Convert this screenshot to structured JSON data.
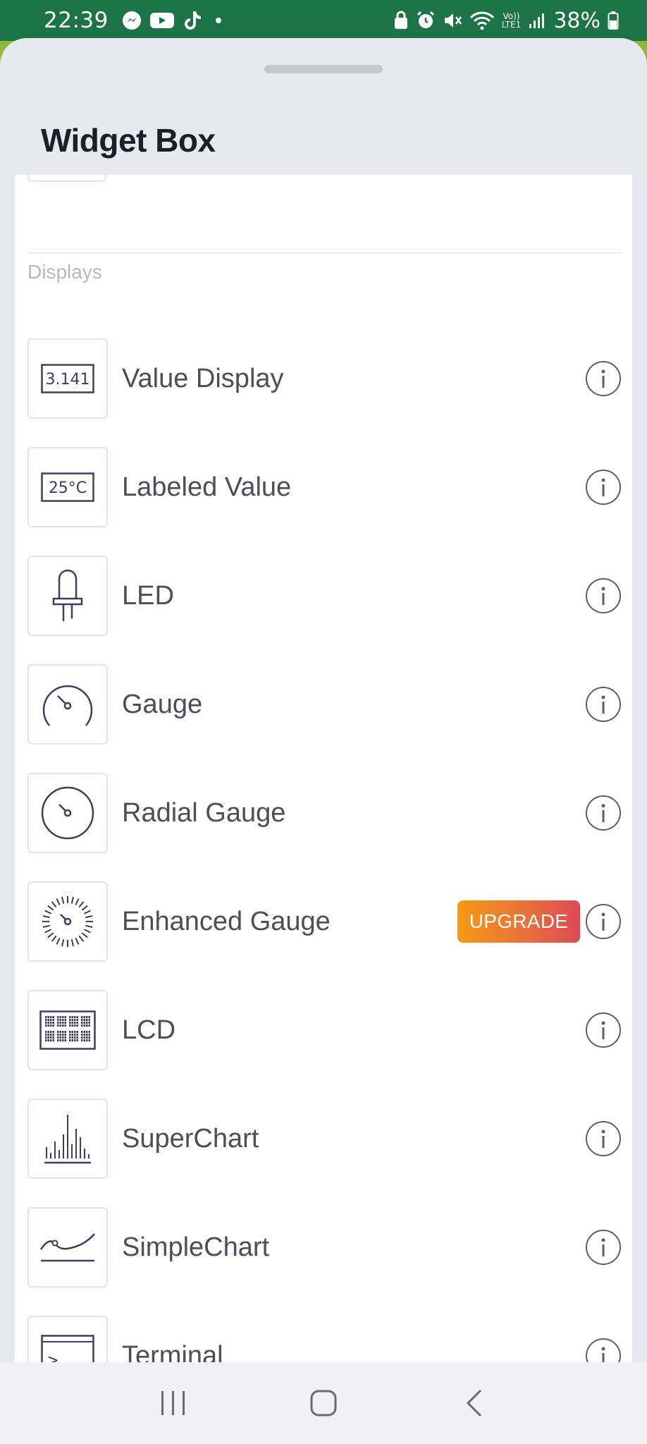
{
  "status_bar": {
    "time": "22:39",
    "battery": "38%",
    "left_icons": [
      "messenger-icon",
      "youtube-icon",
      "tiktok-icon",
      "dot-icon"
    ],
    "right_icons": [
      "sim-lock-icon",
      "alarm-icon",
      "mute-icon",
      "wifi-icon",
      "volte-icon",
      "signal-icon",
      "battery-icon"
    ],
    "network_label_top": "Vo))",
    "network_label_bottom": "LTE1"
  },
  "sheet": {
    "title": "Widget Box",
    "section": "Displays"
  },
  "widgets": [
    {
      "label": "Value Display",
      "icon": "value-display-icon",
      "icon_text": "3.141",
      "upgrade": ""
    },
    {
      "label": "Labeled Value",
      "icon": "labeled-value-icon",
      "icon_text": "25°C",
      "upgrade": ""
    },
    {
      "label": "LED",
      "icon": "led-icon",
      "upgrade": ""
    },
    {
      "label": "Gauge",
      "icon": "gauge-icon",
      "upgrade": ""
    },
    {
      "label": "Radial Gauge",
      "icon": "radial-gauge-icon",
      "upgrade": ""
    },
    {
      "label": "Enhanced Gauge",
      "icon": "enhanced-gauge-icon",
      "upgrade": "UPGRADE"
    },
    {
      "label": "LCD",
      "icon": "lcd-icon",
      "upgrade": ""
    },
    {
      "label": "SuperChart",
      "icon": "superchart-icon",
      "upgrade": ""
    },
    {
      "label": "SimpleChart",
      "icon": "simplechart-icon",
      "upgrade": ""
    },
    {
      "label": "Terminal",
      "icon": "terminal-icon",
      "icon_text": ">_",
      "upgrade": ""
    }
  ],
  "nav": {
    "recents": "recents-icon",
    "home": "home-icon",
    "back": "back-icon"
  },
  "colors": {
    "status_bar": "#1b7346",
    "icon_stroke": "#3a3f63",
    "upgrade_start": "#f49a12",
    "upgrade_end": "#dc4a55"
  }
}
